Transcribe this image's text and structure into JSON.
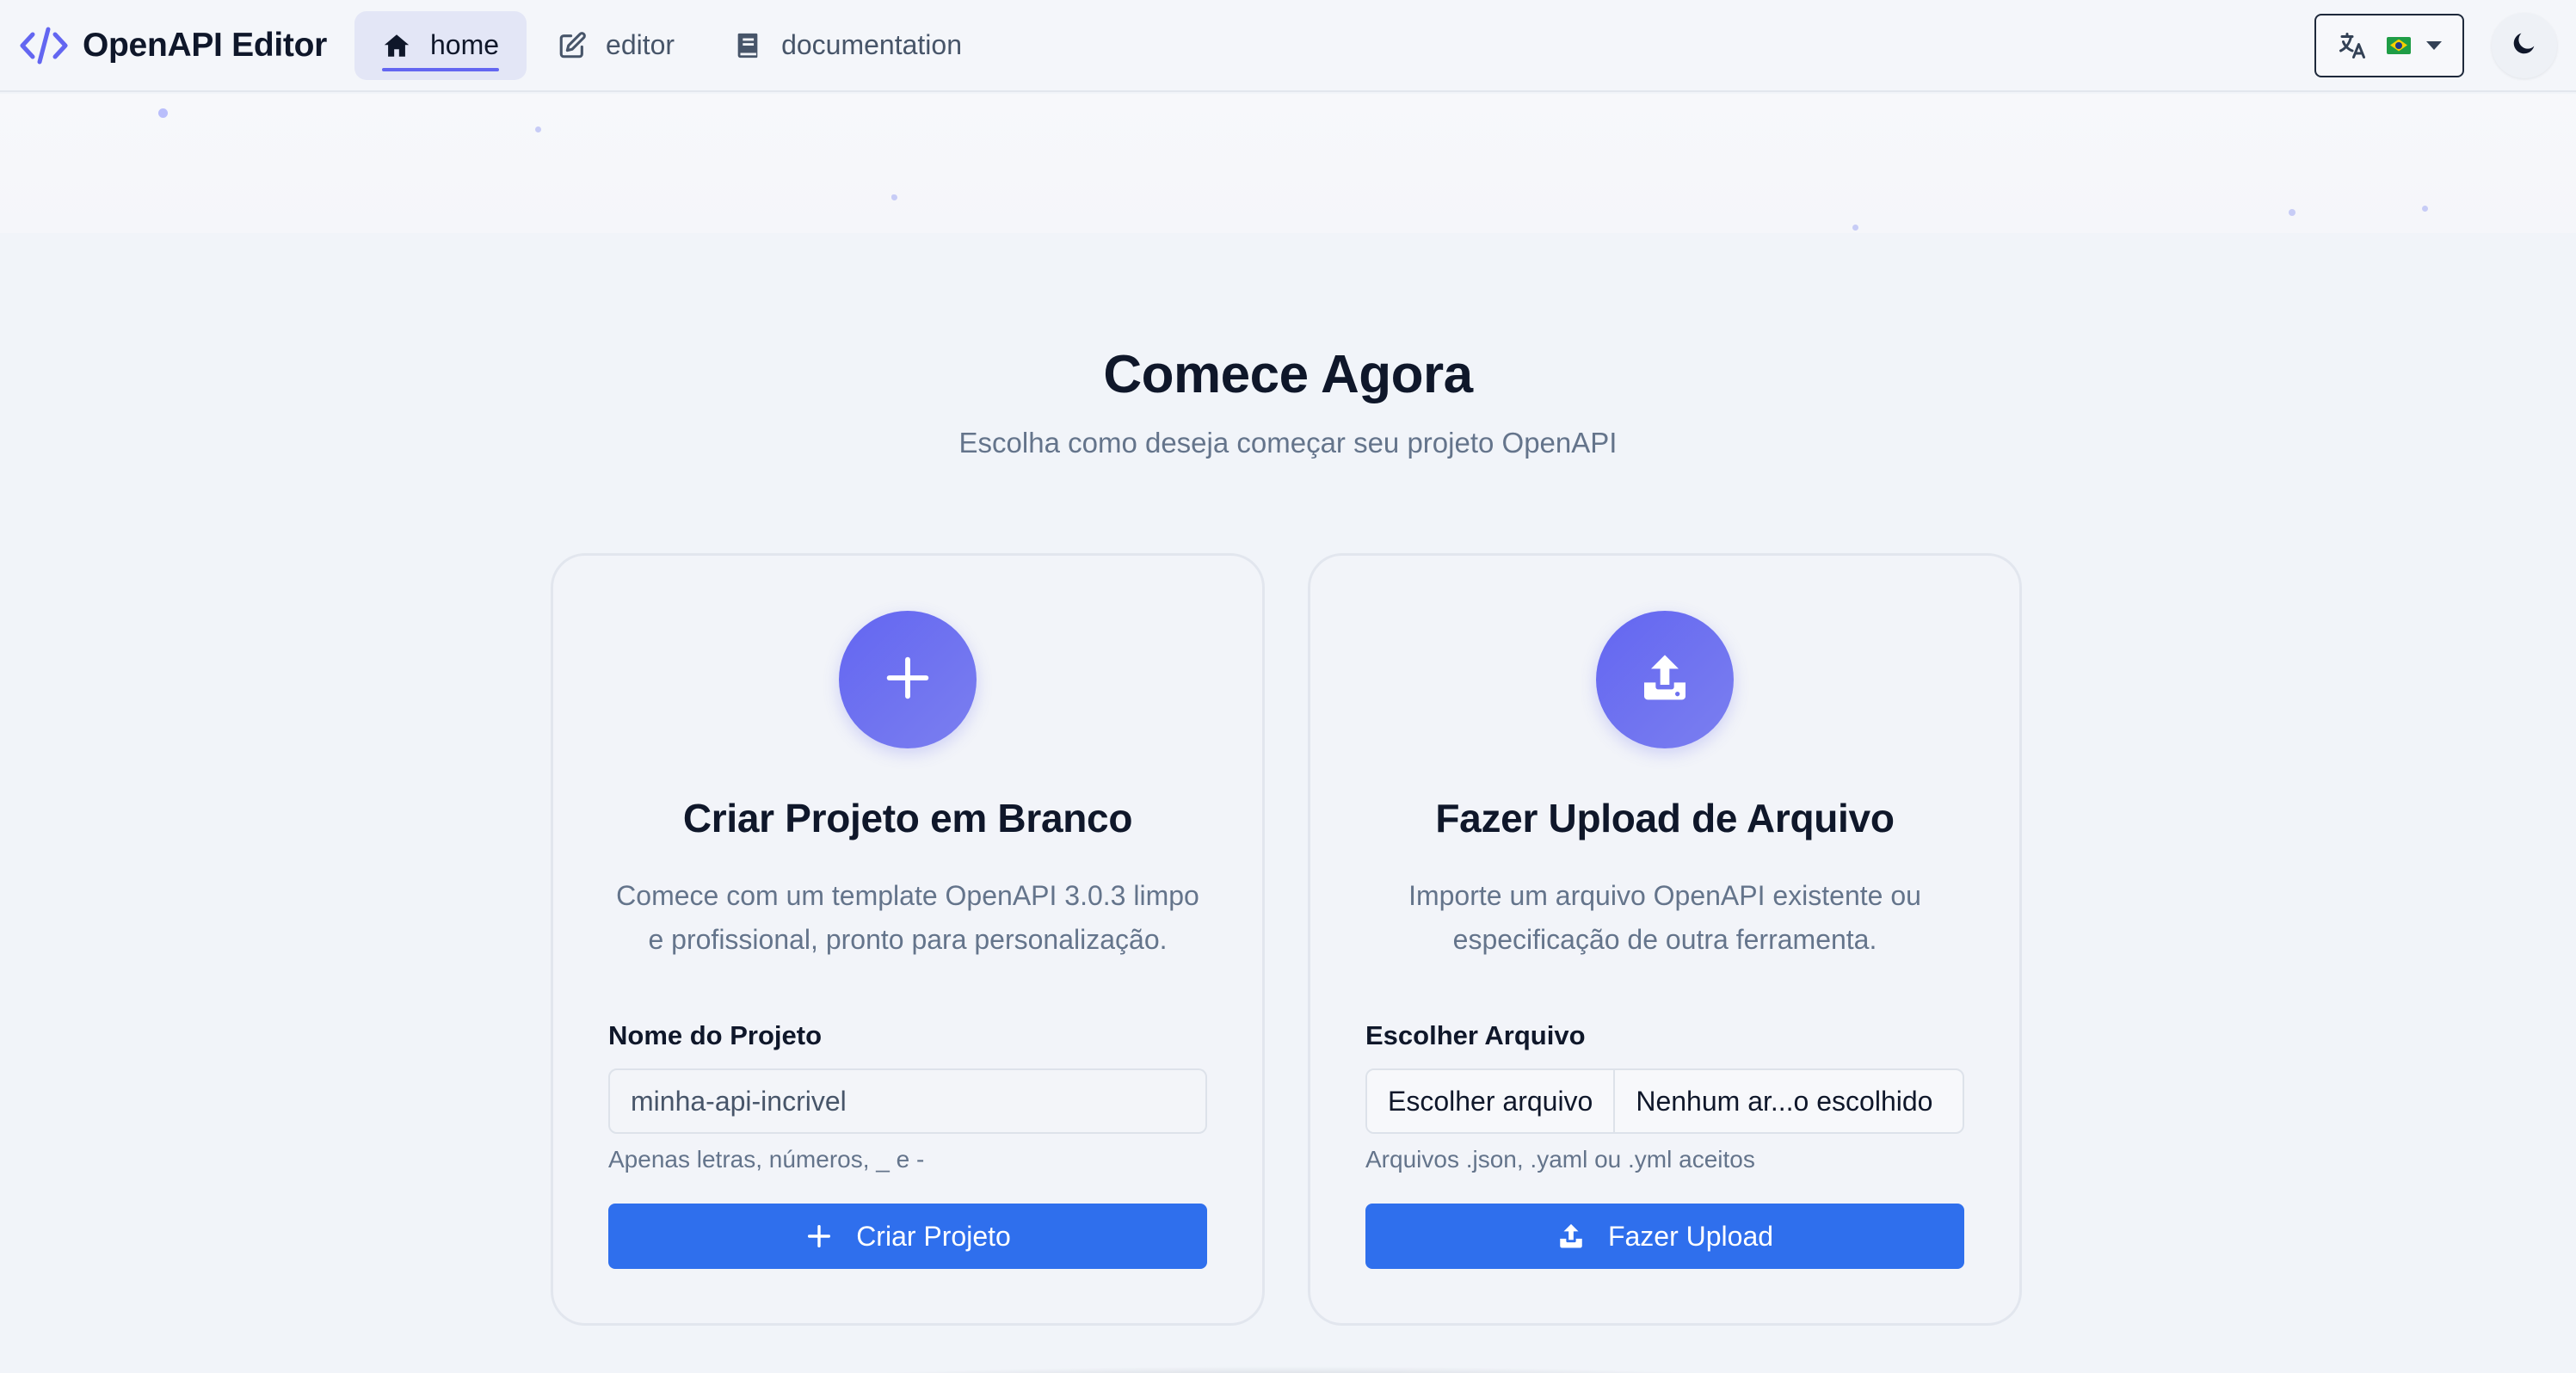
{
  "app": {
    "title": "OpenAPI Editor",
    "logo_icon": "code-icon"
  },
  "nav": {
    "tabs": [
      {
        "label": "home",
        "icon": "home-icon",
        "active": true
      },
      {
        "label": "editor",
        "icon": "edit-icon",
        "active": false
      },
      {
        "label": "documentation",
        "icon": "book-icon",
        "active": false
      }
    ],
    "language": {
      "icon": "translate-icon",
      "flag": "brazil-flag-icon"
    },
    "theme_toggle": {
      "icon": "moon-icon"
    }
  },
  "main": {
    "title": "Comece Agora",
    "subtitle": "Escolha como deseja começar seu projeto OpenAPI"
  },
  "blank_card": {
    "icon": "plus-icon",
    "title": "Criar Projeto em Branco",
    "description": "Comece com um template OpenAPI 3.0.3 limpo e profissional, pronto para personalização.",
    "field_label": "Nome do Projeto",
    "input_value": "minha-api-incrivel",
    "hint": "Apenas letras, números, _ e -",
    "button_label": "Criar Projeto",
    "button_icon": "plus-icon"
  },
  "upload_card": {
    "icon": "upload-icon",
    "title": "Fazer Upload de Arquivo",
    "description": "Importe um arquivo OpenAPI existente ou especificação de outra ferramenta.",
    "field_label": "Escolher Arquivo",
    "choose_button": "Escolher arquivo",
    "file_name": "Nenhum ar...o escolhido",
    "hint": "Arquivos .json, .yaml ou .yml aceitos",
    "button_label": "Fazer Upload",
    "button_icon": "upload-icon"
  },
  "colors": {
    "accent": "#6366f1",
    "primary_button": "#2f6fed",
    "background": "#f1f4f9",
    "text_primary": "#0f172a",
    "text_muted": "#64748b"
  }
}
